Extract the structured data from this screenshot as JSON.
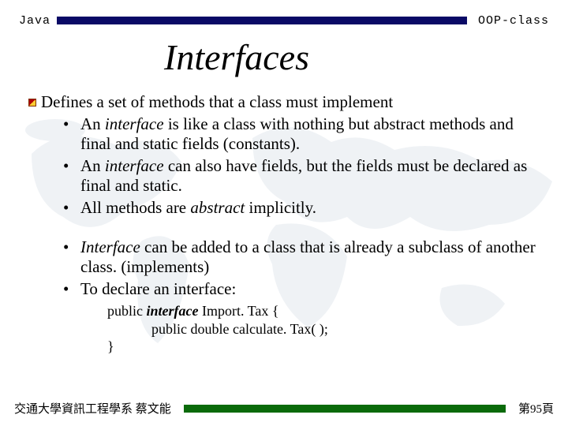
{
  "header": {
    "left": "Java",
    "right": "OOP-class"
  },
  "title": "Interfaces",
  "main_point": "Defines a set of methods that a class must implement",
  "sub_a": [
    {
      "pre": "An ",
      "em": "interface",
      "post": " is like a class with nothing but abstract methods and final and static fields (constants)."
    },
    {
      "pre": "An ",
      "em": "interface",
      "post": " can also have fields, but the fields must be declared as final and static."
    },
    {
      "pre": "All methods are ",
      "em": "abstract",
      "post": " implicitly."
    }
  ],
  "sub_b": [
    {
      "em": "Interface",
      "post": " can be added to a class that is already a subclass of another class. (implements)"
    },
    {
      "pre": "To declare an interface:"
    }
  ],
  "code": {
    "l1a": "public ",
    "l1b": "interface",
    "l1c": " Import. Tax {",
    "l2": "public double calculate. Tax( );",
    "l3": "}"
  },
  "footer": {
    "left": "交通大學資訊工程學系 蔡文能",
    "right": "第95頁"
  }
}
